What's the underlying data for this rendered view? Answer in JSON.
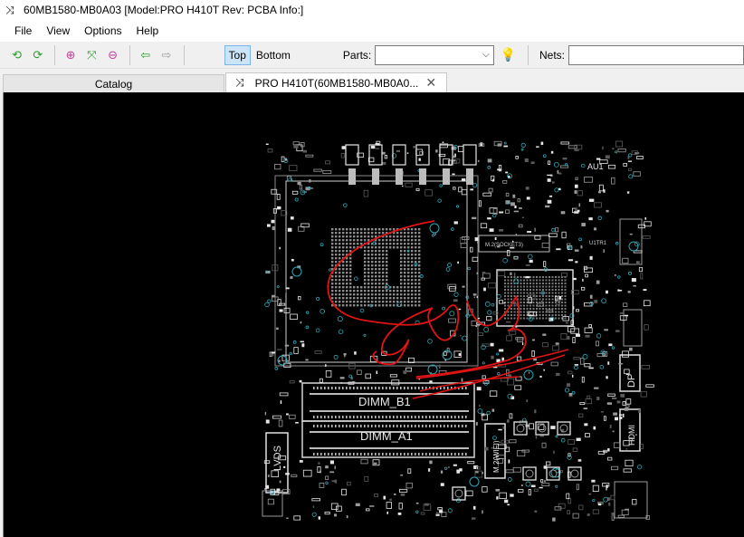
{
  "window": {
    "title": "60MB1580-MB0A03 [Model:PRO H410T Rev: PCBA Info:]",
    "icon": "shuffle-icon"
  },
  "menu": [
    "File",
    "View",
    "Options",
    "Help"
  ],
  "toolbar": {
    "layers": {
      "top": "Top",
      "bottom": "Bottom",
      "active": "Top"
    },
    "parts_label": "Parts:",
    "parts_value": "",
    "nets_label": "Nets:",
    "nets_value": "",
    "icons": [
      "rotate-left-icon",
      "rotate-right-icon",
      "zoom-in-icon",
      "fit-icon",
      "zoom-out-icon",
      "back-arrow-icon",
      "forward-arrow-icon",
      "highlight-bulb-icon"
    ]
  },
  "tabs": {
    "catalog": "Catalog",
    "board": "PRO H410T(60MB1580-MB0A0..."
  },
  "board": {
    "labels": {
      "dimm_b1": "DIMM_B1",
      "dimm_a1": "DIMM_A1",
      "lvds": "LVDS",
      "m2_wifi": "M.2(WIFI)",
      "dp": "DP",
      "hdmi": "HDMI",
      "au1": "AU1",
      "m2_socket3": "M.2(SOCKET3)",
      "u1tr1": "U1TR1"
    },
    "colors": {
      "background": "#000000",
      "silkscreen": "#e8e8e8",
      "pads": "#9a9a9a",
      "vias": "#2fa6b5",
      "annotation": "#e01414"
    }
  }
}
